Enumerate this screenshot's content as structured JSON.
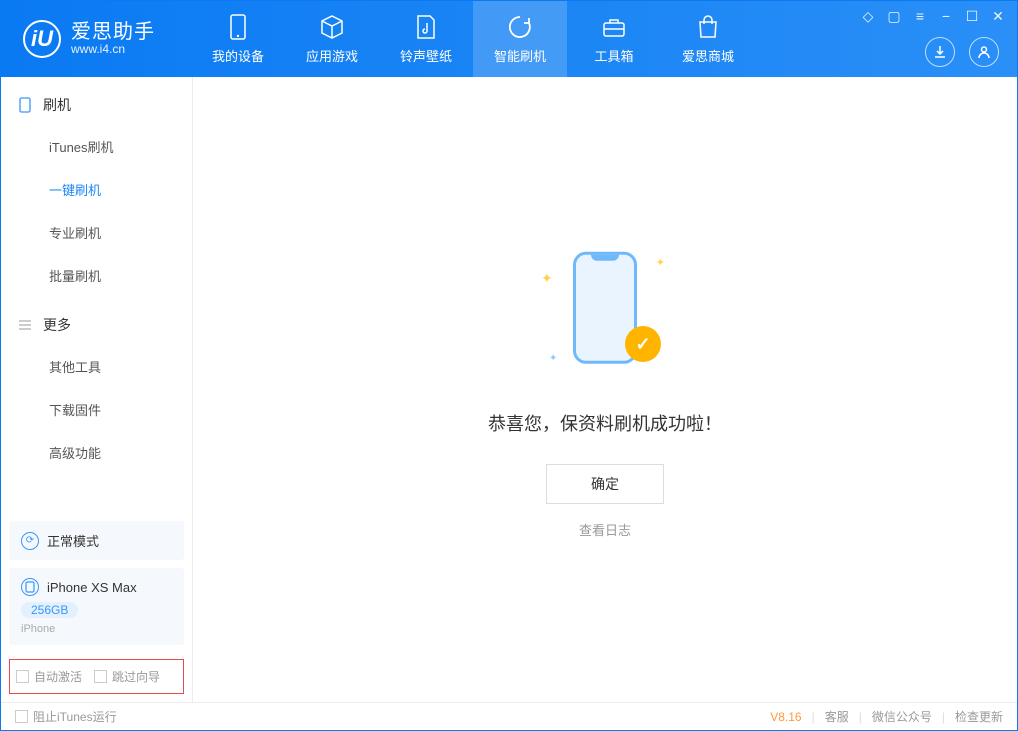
{
  "app": {
    "logo_letter": "iU",
    "title": "爱思助手",
    "subtitle": "www.i4.cn"
  },
  "nav": {
    "items": [
      {
        "label": "我的设备"
      },
      {
        "label": "应用游戏"
      },
      {
        "label": "铃声壁纸"
      },
      {
        "label": "智能刷机"
      },
      {
        "label": "工具箱"
      },
      {
        "label": "爱思商城"
      }
    ]
  },
  "sidebar": {
    "section1_title": "刷机",
    "section1_items": [
      {
        "label": "iTunes刷机"
      },
      {
        "label": "一键刷机"
      },
      {
        "label": "专业刷机"
      },
      {
        "label": "批量刷机"
      }
    ],
    "section2_title": "更多",
    "section2_items": [
      {
        "label": "其他工具"
      },
      {
        "label": "下载固件"
      },
      {
        "label": "高级功能"
      }
    ],
    "mode_label": "正常模式",
    "device_name": "iPhone XS Max",
    "device_storage": "256GB",
    "device_type": "iPhone",
    "checkbox1": "自动激活",
    "checkbox2": "跳过向导"
  },
  "main": {
    "success_text": "恭喜您，保资料刷机成功啦！",
    "ok_button": "确定",
    "view_log": "查看日志"
  },
  "footer": {
    "block_itunes": "阻止iTunes运行",
    "version": "V8.16",
    "link1": "客服",
    "link2": "微信公众号",
    "link3": "检查更新"
  }
}
